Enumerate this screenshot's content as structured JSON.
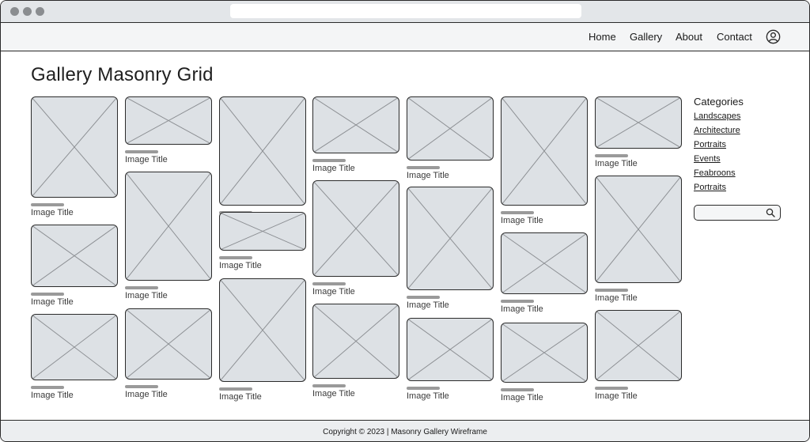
{
  "nav": {
    "items": [
      {
        "label": "Home"
      },
      {
        "label": "Gallery"
      },
      {
        "label": "About"
      },
      {
        "label": "Contact"
      }
    ]
  },
  "page": {
    "title": "Gallery Masonry Grid"
  },
  "gallery": {
    "caption": "Image Title",
    "items": [
      {
        "title": "Image Title"
      },
      {
        "title": "Image Title"
      },
      {
        "title": "Image Title"
      },
      {
        "title": "Image Title"
      },
      {
        "title": "Image Title"
      },
      {
        "title": "Image Title"
      },
      {
        "title": "Image Title"
      },
      {
        "title": "Image Title"
      },
      {
        "title": "Image Title"
      },
      {
        "title": "Image Title"
      },
      {
        "title": "Image Title"
      },
      {
        "title": "Image Title"
      },
      {
        "title": "Image Title"
      },
      {
        "title": "Image Title"
      },
      {
        "title": "Image Title"
      },
      {
        "title": "Image Title"
      },
      {
        "title": "Image Title"
      },
      {
        "title": "Image Title"
      },
      {
        "title": "Image Title"
      },
      {
        "title": "Image Title"
      },
      {
        "title": "Image Title"
      },
      {
        "title": "Image Title"
      }
    ]
  },
  "sidebar": {
    "heading": "Categories",
    "categories": [
      "Landscapes",
      "Architecture",
      "Portraits",
      "Events",
      "Feabroons",
      "Portraits"
    ],
    "search_placeholder": ""
  },
  "footer": {
    "text": "Copyright © 2023 | Masonry Gallery Wireframe"
  },
  "colors": {
    "placeholder_fill": "#dde1e5",
    "border": "#2b2b2b",
    "caption_bar": "#9a9a9a",
    "chrome": "#e3e6e9"
  }
}
